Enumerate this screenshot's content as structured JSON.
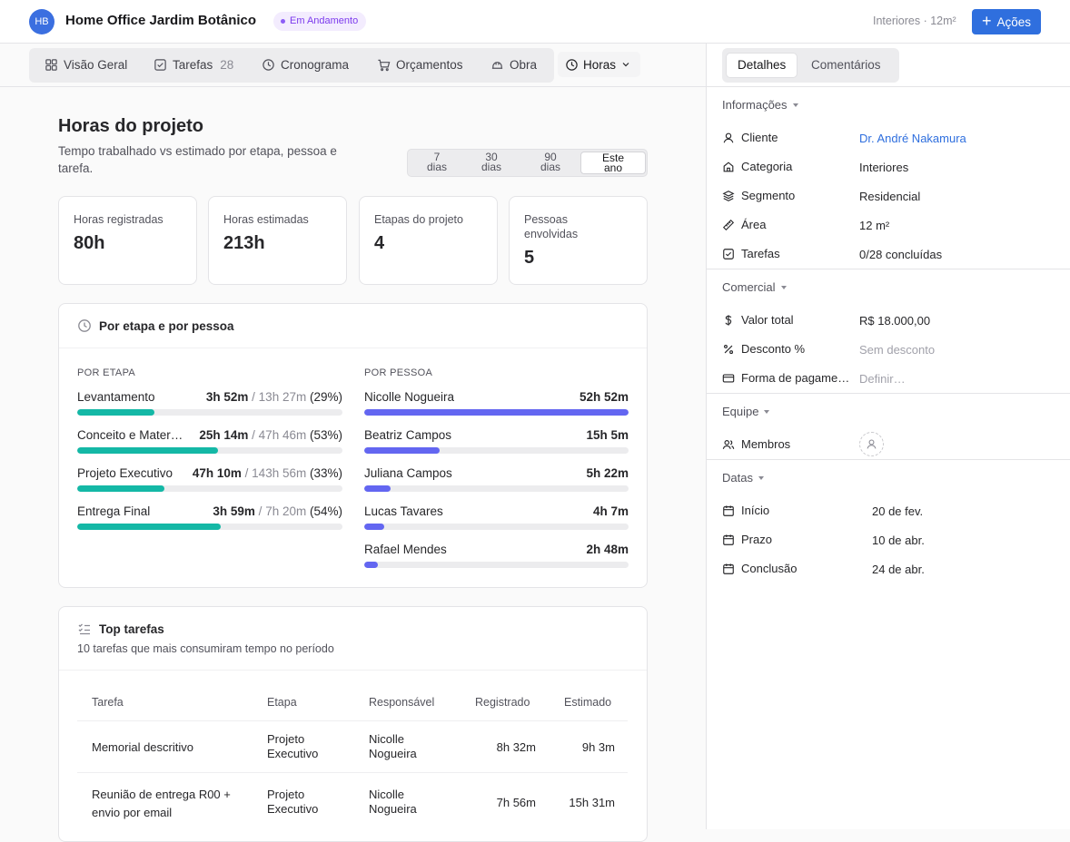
{
  "header": {
    "avatar_initials": "HB",
    "project_title": "Home Office Jardim Botânico",
    "status": "Em Andamento",
    "meta": "Interiores · 12m²",
    "actions_label": "Ações"
  },
  "tabs": {
    "overview": "Visão Geral",
    "tasks": "Tarefas",
    "tasks_count": "28",
    "schedule": "Cronograma",
    "budgets": "Orçamentos",
    "construction": "Obra",
    "hours": "Horas"
  },
  "hours": {
    "title": "Horas do projeto",
    "subtitle": "Tempo trabalhado vs estimado por etapa, pessoa e tarefa.",
    "ranges": [
      {
        "line1": "7",
        "line2": "dias"
      },
      {
        "line1": "30",
        "line2": "dias"
      },
      {
        "line1": "90",
        "line2": "dias"
      },
      {
        "line1": "Este",
        "line2": "ano"
      }
    ],
    "active_range": 3,
    "stats": [
      {
        "label": "Horas registradas",
        "value": "80h"
      },
      {
        "label": "Horas estimadas",
        "value": "213h"
      },
      {
        "label": "Etapas do projeto",
        "value": "4"
      },
      {
        "label": "Pessoas envolvidas",
        "value": "5"
      }
    ],
    "breakdown": {
      "title": "Por etapa e por pessoa",
      "stage_title": "POR ETAPA",
      "person_title": "POR PESSOA",
      "stages": [
        {
          "name": "Levantamento",
          "logged": "3h 52m",
          "estimated": "13h 27m",
          "pct_label": "(29%)",
          "progress": 0.29
        },
        {
          "name": "Conceito e Mater…",
          "logged": "25h 14m",
          "estimated": "47h 46m",
          "pct_label": "(53%)",
          "progress": 0.53
        },
        {
          "name": "Projeto Executivo",
          "logged": "47h 10m",
          "estimated": "143h 56m",
          "pct_label": "(33%)",
          "progress": 0.33
        },
        {
          "name": "Entrega Final",
          "logged": "3h 59m",
          "estimated": "7h 20m",
          "pct_label": "(54%)",
          "progress": 0.54
        }
      ],
      "people": [
        {
          "name": "Nicolle Nogueira",
          "logged": "52h 52m",
          "progress": 1.0
        },
        {
          "name": "Beatriz Campos",
          "logged": "15h 5m",
          "progress": 0.285
        },
        {
          "name": "Juliana Campos",
          "logged": "5h 22m",
          "progress": 0.1
        },
        {
          "name": "Lucas Tavares",
          "logged": "4h 7m",
          "progress": 0.075
        },
        {
          "name": "Rafael Mendes",
          "logged": "2h 48m",
          "progress": 0.05
        }
      ]
    },
    "top_tasks": {
      "title": "Top tarefas",
      "subtitle": "10 tarefas que mais consumiram tempo no período",
      "columns": [
        "Tarefa",
        "Etapa",
        "Responsável",
        "Registrado",
        "Estimado"
      ],
      "rows": [
        {
          "task": "Memorial descritivo",
          "stage": "Projeto Executivo",
          "owner": "Nicolle Nogueira",
          "logged": "8h 32m",
          "estimated": "9h 3m"
        },
        {
          "task": "Reunião de entrega R00 + envio por email",
          "stage": "Projeto Executivo",
          "owner": "Nicolle Nogueira",
          "logged": "7h 56m",
          "estimated": "15h 31m"
        }
      ]
    }
  },
  "sidebar": {
    "tab_details": "Detalhes",
    "tab_comments": "Comentários",
    "info": {
      "title": "Informações",
      "client_label": "Cliente",
      "client_value": "Dr. André Nakamura",
      "category_label": "Categoria",
      "category_value": "Interiores",
      "segment_label": "Segmento",
      "segment_value": "Residencial",
      "area_label": "Área",
      "area_value": "12 m²",
      "tasks_label": "Tarefas",
      "tasks_value": "0/28 concluídas"
    },
    "commercial": {
      "title": "Comercial",
      "total_label": "Valor total",
      "total_value": "R$ 18.000,00",
      "discount_label": "Desconto %",
      "discount_value": "Sem desconto",
      "payment_label": "Forma de pagame…",
      "payment_value": "Definir…"
    },
    "team": {
      "title": "Equipe",
      "members_label": "Membros"
    },
    "dates": {
      "title": "Datas",
      "start_label": "Início",
      "start_value": "20 de fev.",
      "due_label": "Prazo",
      "due_value": "10 de abr.",
      "done_label": "Conclusão",
      "done_value": "24 de abr."
    }
  },
  "colors": {
    "accent": "#2f6fde",
    "status": "#7c3aed",
    "stage_bar": "#14b8a6",
    "person_bar": "#6366f1"
  }
}
